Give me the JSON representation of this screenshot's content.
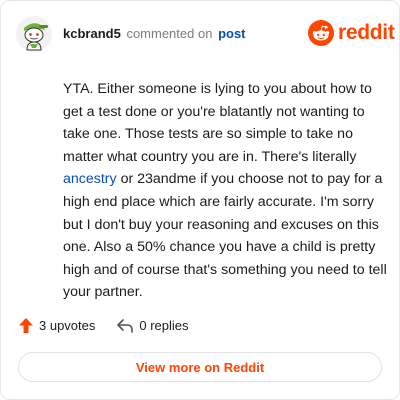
{
  "header": {
    "username": "kcbrand5",
    "action_text": "commented on",
    "post_link_text": "post",
    "brand_name": "reddit"
  },
  "comment": {
    "text_before_link": "YTA. Either someone is lying to you about how to get a test done or you're blatantly not wanting to take one. Those tests are so simple to take no matter what country you are in. There's literally ",
    "link_text": "ancestry",
    "text_after_link": " or 23andme if you choose not to pay for a high end place which are fairly accurate. I'm sorry but I don't buy your reasoning and excuses on this one. Also a 50% chance you have a child is pretty high and of course that's something you need to tell your partner."
  },
  "stats": {
    "upvotes": "3 upvotes",
    "replies": "0 replies"
  },
  "cta": {
    "label": "View more on Reddit"
  },
  "icons": {
    "upvote": "upvote-arrow-icon",
    "reply": "reply-arrow-icon",
    "brand": "reddit-alien-logo-icon",
    "avatar": "snoo-avatar-icon"
  },
  "colors": {
    "brand": "#ff4500",
    "link": "#0a4fb8",
    "muted": "#7c7c7c",
    "avatar_green": "#6fb33b"
  }
}
